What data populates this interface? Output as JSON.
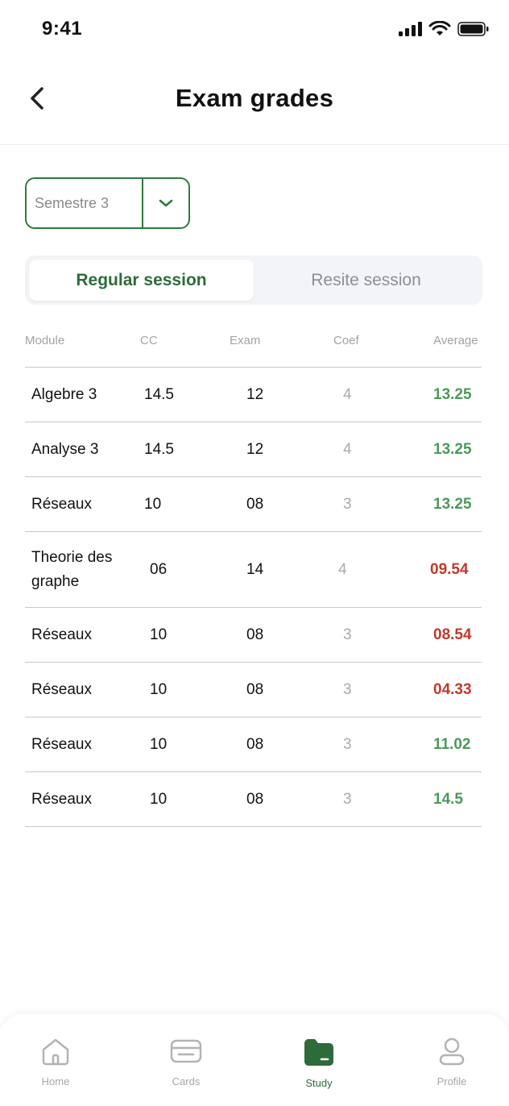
{
  "status_bar": {
    "time": "9:41"
  },
  "header": {
    "title": "Exam grades"
  },
  "semester_select": {
    "value": "Semestre 3"
  },
  "session_tabs": [
    {
      "label": "Regular session",
      "active": true
    },
    {
      "label": "Resite session",
      "active": false
    }
  ],
  "table": {
    "headers": {
      "module": "Module",
      "cc": "CC",
      "exam": "Exam",
      "coef": "Coef",
      "average": "Average"
    },
    "rows": [
      {
        "module": "Algebre 3",
        "cc": "14.5",
        "exam": "12",
        "coef": "4",
        "average": "13.25",
        "status": "pass"
      },
      {
        "module": "Analyse 3",
        "cc": "14.5",
        "exam": "12",
        "coef": "4",
        "average": "13.25",
        "status": "pass"
      },
      {
        "module": "Réseaux",
        "cc": "10",
        "exam": "08",
        "coef": "3",
        "average": "13.25",
        "status": "pass"
      },
      {
        "module": "Theorie des graphe",
        "cc": "06",
        "exam": "14",
        "coef": "4",
        "average": "09.54",
        "status": "fail"
      },
      {
        "module": "Réseaux",
        "cc": "10",
        "exam": "08",
        "coef": "3",
        "average": "08.54",
        "status": "fail"
      },
      {
        "module": "Réseaux",
        "cc": "10",
        "exam": "08",
        "coef": "3",
        "average": "04.33",
        "status": "fail"
      },
      {
        "module": "Réseaux",
        "cc": "10",
        "exam": "08",
        "coef": "3",
        "average": "11.02",
        "status": "pass"
      },
      {
        "module": "Réseaux",
        "cc": "10",
        "exam": "08",
        "coef": "3",
        "average": "14.5",
        "status": "pass"
      }
    ]
  },
  "bottom_nav": [
    {
      "label": "Home",
      "icon": "home-icon",
      "active": false
    },
    {
      "label": "Cards",
      "icon": "card-icon",
      "active": false
    },
    {
      "label": "Study",
      "icon": "folder-icon",
      "active": true
    },
    {
      "label": "Profile",
      "icon": "profile-icon",
      "active": false
    }
  ],
  "colors": {
    "accent": "#2e7a3c",
    "pass": "#4a9a5a",
    "fail": "#c0392b"
  }
}
